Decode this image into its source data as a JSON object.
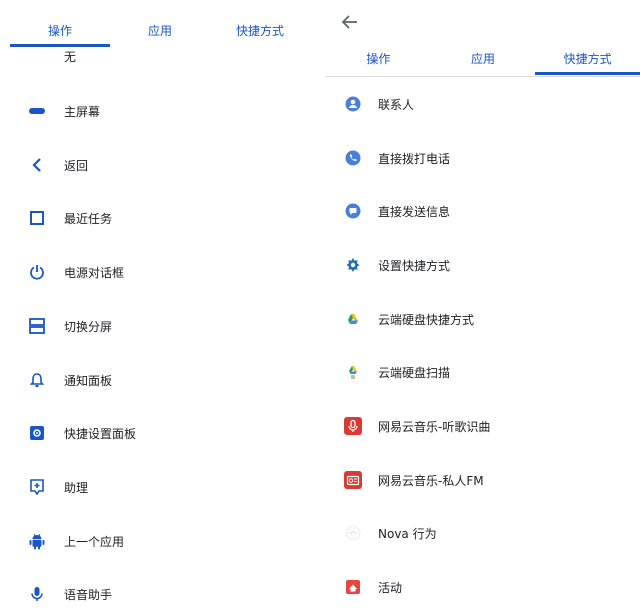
{
  "tabs": [
    "操作",
    "应用",
    "快捷方式"
  ],
  "actions": {
    "none_label": "无",
    "items": [
      {
        "label": "主屏幕",
        "icon": "home-pill-icon"
      },
      {
        "label": "返回",
        "icon": "back-chevron-icon"
      },
      {
        "label": "最近任务",
        "icon": "recents-square-icon"
      },
      {
        "label": "电源对话框",
        "icon": "power-icon"
      },
      {
        "label": "切换分屏",
        "icon": "split-screen-icon"
      },
      {
        "label": "通知面板",
        "icon": "bell-icon"
      },
      {
        "label": "快捷设置面板",
        "icon": "settings-panel-icon"
      },
      {
        "label": "助理",
        "icon": "assistant-icon"
      },
      {
        "label": "上一个应用",
        "icon": "android-icon"
      },
      {
        "label": "语音助手",
        "icon": "mic-icon"
      }
    ]
  },
  "shortcuts": {
    "items": [
      {
        "label": "联系人",
        "icon": "contact-icon"
      },
      {
        "label": "直接拨打电话",
        "icon": "phone-icon"
      },
      {
        "label": "直接发送信息",
        "icon": "message-icon"
      },
      {
        "label": "设置快捷方式",
        "icon": "gear-icon"
      },
      {
        "label": "云端硬盘快捷方式",
        "icon": "drive-icon"
      },
      {
        "label": "云端硬盘扫描",
        "icon": "drive-scan-icon"
      },
      {
        "label": "网易云音乐-听歌识曲",
        "icon": "netease-mic-icon"
      },
      {
        "label": "网易云音乐-私人FM",
        "icon": "netease-radio-icon"
      },
      {
        "label": "Nova 行为",
        "icon": "nova-icon"
      },
      {
        "label": "活动",
        "icon": "activity-icon"
      }
    ]
  },
  "colors": {
    "accent": "#1a56c4",
    "netease_red": "#d93b32"
  }
}
